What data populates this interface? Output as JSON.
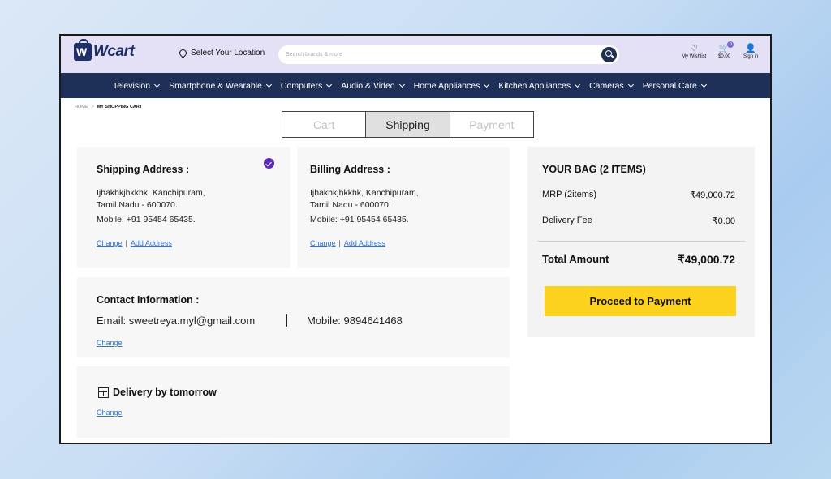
{
  "header": {
    "logo_text": "Wcart",
    "location_label": "Select Your Location",
    "search_placeholder": "Search brands & more",
    "wishlist_label": "My Wishlist",
    "cart_amount": "$0.00",
    "cart_count": "0",
    "signin_label": "Sign in"
  },
  "nav": {
    "items": [
      "Television",
      "Smartphone & Wearable",
      "Computers",
      "Audio & Video",
      "Home Appliances",
      "Kitchen Appliances",
      "Cameras",
      "Personal Care"
    ]
  },
  "breadcrumb": {
    "home": "HOME",
    "separator": ">",
    "current": "MY SHOPPING CART"
  },
  "steps": {
    "cart": "Cart",
    "shipping": "Shipping",
    "payment": "Payment",
    "active": "Shipping"
  },
  "shipping_address": {
    "title": "Shipping Address :",
    "line1": "Ijhakhkjhkkhk, Kanchipuram,",
    "line2": "Tamil Nadu - 600070.",
    "mobile": "Mobile: +91 95454 65435.",
    "change": "Change",
    "add": "Add Address",
    "selected": true
  },
  "billing_address": {
    "title": "Billing Address :",
    "line1": "Ijhakhkjhkkhk, Kanchipuram,",
    "line2": "Tamil Nadu - 600070.",
    "mobile": "Mobile: +91 95454 65435.",
    "change": "Change",
    "add": "Add Address"
  },
  "contact": {
    "title": "Contact Information :",
    "email": "Email: sweetreya.myl@gmail.com",
    "mobile": "Mobile: 9894641468",
    "change": "Change"
  },
  "delivery": {
    "title": "Delivery by tomorrow",
    "change": "Change"
  },
  "bag": {
    "title": "YOUR BAG (2 ITEMS)",
    "mrp_label": "MRP (2items)",
    "mrp_value": "₹49,000.72",
    "fee_label": "Delivery Fee",
    "fee_value": "₹0.00",
    "total_label": "Total Amount",
    "total_value": "₹49,000.72",
    "button": "Proceed to Payment"
  },
  "colors": {
    "header_bg": "#e4e1f7",
    "nav_bg": "#1e3057",
    "brand": "#1f2f6a",
    "link": "#2f74d8",
    "check": "#5a2bb8",
    "cta": "#fcd21f"
  }
}
